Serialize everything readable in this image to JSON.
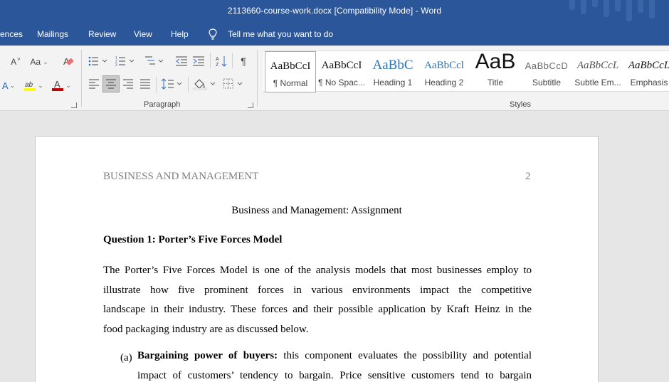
{
  "window": {
    "title": "2113660-course-work.docx [Compatibility Mode]  -  Word"
  },
  "menu": {
    "items": [
      "ences",
      "Mailings",
      "Review",
      "View",
      "Help"
    ],
    "tell_me": "Tell me what you want to do"
  },
  "ribbon": {
    "font_controls": {
      "shrink": "A",
      "case": "Aa"
    },
    "paragraph_label": "Paragraph",
    "styles_label": "Styles",
    "styles": [
      {
        "preview": "AaBbCcI",
        "label": "¶ Normal"
      },
      {
        "preview": "AaBbCcI",
        "label": "¶ No Spac..."
      },
      {
        "preview": "AaBbC",
        "label": "Heading 1"
      },
      {
        "preview": "AaBbCcl",
        "label": "Heading 2"
      },
      {
        "preview": "AaB",
        "label": "Title"
      },
      {
        "preview": "AaBbCcD",
        "label": "Subtitle"
      },
      {
        "preview": "AaBbCcL",
        "label": "Subtle Em..."
      },
      {
        "preview": "AaBbCcL",
        "label": "Emphasis"
      }
    ]
  },
  "document": {
    "header_left": "BUSINESS AND MANAGEMENT",
    "header_page": "2",
    "title": "Business and Management: Assignment",
    "question_heading": "Question 1: Porter’s Five Forces Model",
    "paragraph_lines": [
      "The Porter’s Five Forces Model is one of the analysis models that most businesses employ to",
      "illustrate how five prominent forces in various environments impact the competitive",
      "landscape in their industry. These forces and their possible application by Kraft Heinz in the",
      "food packaging industry are as discussed below."
    ],
    "list_item": {
      "marker": "(a)",
      "bold_lead": "Bargaining power of buyers:",
      "line1_rest": " this component evaluates the possibility and potential",
      "line2": "impact of customers’ tendency to bargain. Price sensitive customers tend to bargain"
    }
  },
  "colors": {
    "titlebar": "#2b579a",
    "ribbon": "#f3f3f3",
    "canvas": "#e6e6e6",
    "font_color_bar": "#c00000",
    "highlight_bar": "#ffff00",
    "heading_blue": "#2e74b5"
  }
}
